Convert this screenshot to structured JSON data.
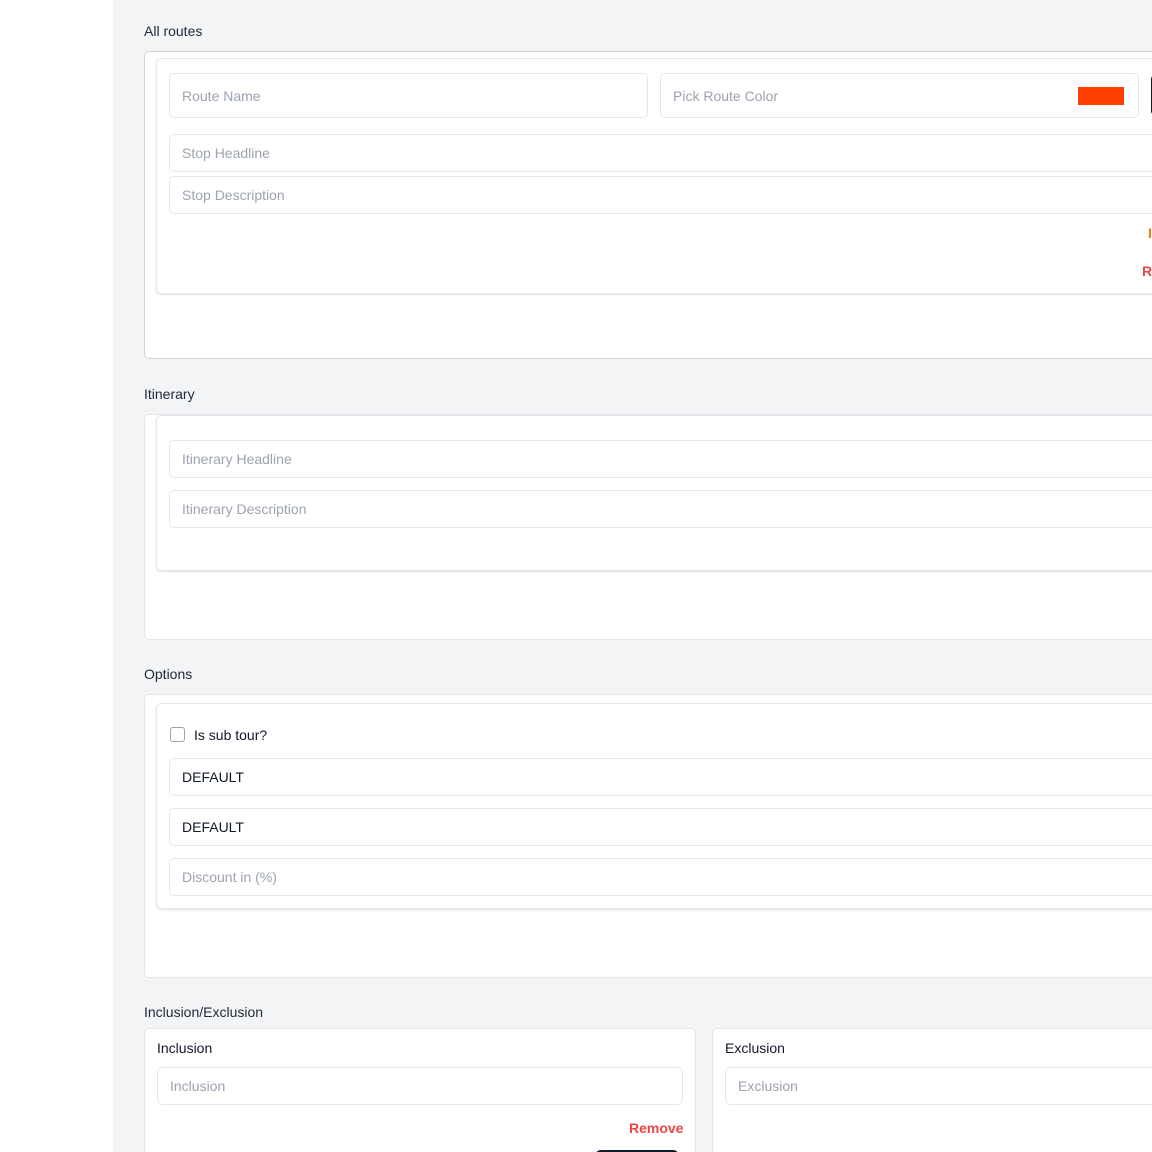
{
  "routes": {
    "title": "All routes",
    "route_name_placeholder": "Route Name",
    "route_color_placeholder": "Pick Route Color",
    "route_color_value": "#ff3f00",
    "stop_headline_placeholder": "Stop Headline",
    "stop_description_placeholder": "Stop Description",
    "clipped_link_1": "I",
    "clipped_link_2": "R"
  },
  "itinerary": {
    "title": "Itinerary",
    "headline_placeholder": "Itinerary Headline",
    "description_placeholder": "Itinerary Description"
  },
  "options": {
    "title": "Options",
    "sub_tour_label": "Is sub tour?",
    "sub_tour_checked": false,
    "select_1_value": "DEFAULT",
    "select_2_value": "DEFAULT",
    "discount_placeholder": "Discount in (%)"
  },
  "inclusion_exclusion": {
    "title": "Inclusion/Exclusion",
    "inclusion": {
      "heading": "Inclusion",
      "placeholder": "Inclusion",
      "remove_label": "Remove"
    },
    "exclusion": {
      "heading": "Exclusion",
      "placeholder": "Exclusion"
    }
  },
  "colors": {
    "danger": "#ef4444",
    "accent_orange": "#ea7a14",
    "route_color": "#ff3f00"
  }
}
